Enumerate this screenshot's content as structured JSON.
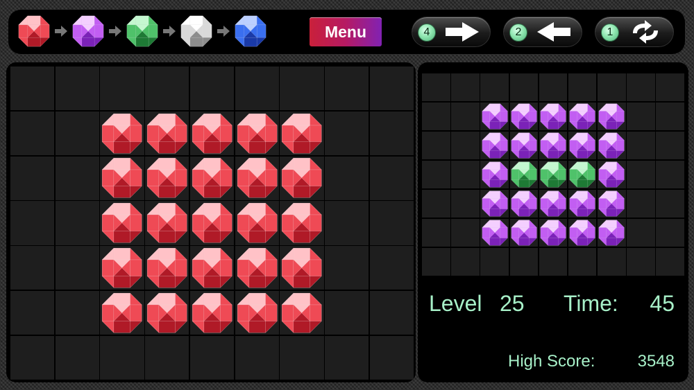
{
  "colors": {
    "red": {
      "base": "#ef4a55",
      "light": "#ffc2c7",
      "dark": "#b01a27"
    },
    "purple": {
      "base": "#c25ef2",
      "light": "#f4cfff",
      "dark": "#7b22b8"
    },
    "green": {
      "base": "#4fc26a",
      "light": "#c4f7d0",
      "dark": "#1e7a35"
    },
    "white": {
      "base": "#d9d9d9",
      "light": "#ffffff",
      "dark": "#8c8c8c"
    },
    "blue": {
      "base": "#3a6ff0",
      "light": "#bcd0ff",
      "dark": "#1a3aa8"
    },
    "accent_text": "#a7f0c8"
  },
  "sequence": [
    "red",
    "purple",
    "green",
    "white",
    "blue"
  ],
  "toolbar": {
    "menu_label": "Menu",
    "actions": [
      {
        "id": "forward",
        "count": "4",
        "icon": "arrow-right-icon"
      },
      {
        "id": "back",
        "count": "2",
        "icon": "arrow-left-icon"
      },
      {
        "id": "swap",
        "count": "1",
        "icon": "swap-arrows-icon"
      }
    ]
  },
  "main_board": {
    "rows": 7,
    "cols": 9,
    "gems": [
      [
        ".",
        ".",
        ".",
        ".",
        ".",
        ".",
        ".",
        ".",
        "."
      ],
      [
        ".",
        ".",
        "R",
        "R",
        "R",
        "R",
        "R",
        ".",
        "."
      ],
      [
        ".",
        ".",
        "R",
        "R",
        "R",
        "R",
        "R",
        ".",
        "."
      ],
      [
        ".",
        ".",
        "R",
        "R",
        "R",
        "R",
        "R",
        ".",
        "."
      ],
      [
        ".",
        ".",
        "R",
        "R",
        "R",
        "R",
        "R",
        ".",
        "."
      ],
      [
        ".",
        ".",
        "R",
        "R",
        "R",
        "R",
        "R",
        ".",
        "."
      ],
      [
        ".",
        ".",
        ".",
        ".",
        ".",
        ".",
        ".",
        ".",
        "."
      ]
    ]
  },
  "target_board": {
    "rows": 7,
    "cols": 9,
    "gems": [
      [
        ".",
        ".",
        ".",
        ".",
        ".",
        ".",
        ".",
        ".",
        "."
      ],
      [
        ".",
        ".",
        "P",
        "P",
        "P",
        "P",
        "P",
        ".",
        "."
      ],
      [
        ".",
        ".",
        "P",
        "P",
        "P",
        "P",
        "P",
        ".",
        "."
      ],
      [
        ".",
        ".",
        "P",
        "G",
        "G",
        "G",
        "P",
        ".",
        "."
      ],
      [
        ".",
        ".",
        "P",
        "P",
        "P",
        "P",
        "P",
        ".",
        "."
      ],
      [
        ".",
        ".",
        "P",
        "P",
        "P",
        "P",
        "P",
        ".",
        "."
      ],
      [
        ".",
        ".",
        ".",
        ".",
        ".",
        ".",
        ".",
        ".",
        "."
      ]
    ]
  },
  "stats": {
    "level_label": "Level",
    "level_value": "25",
    "time_label": "Time:",
    "time_value": "45",
    "high_score_label": "High Score:",
    "high_score_value": "3548"
  }
}
